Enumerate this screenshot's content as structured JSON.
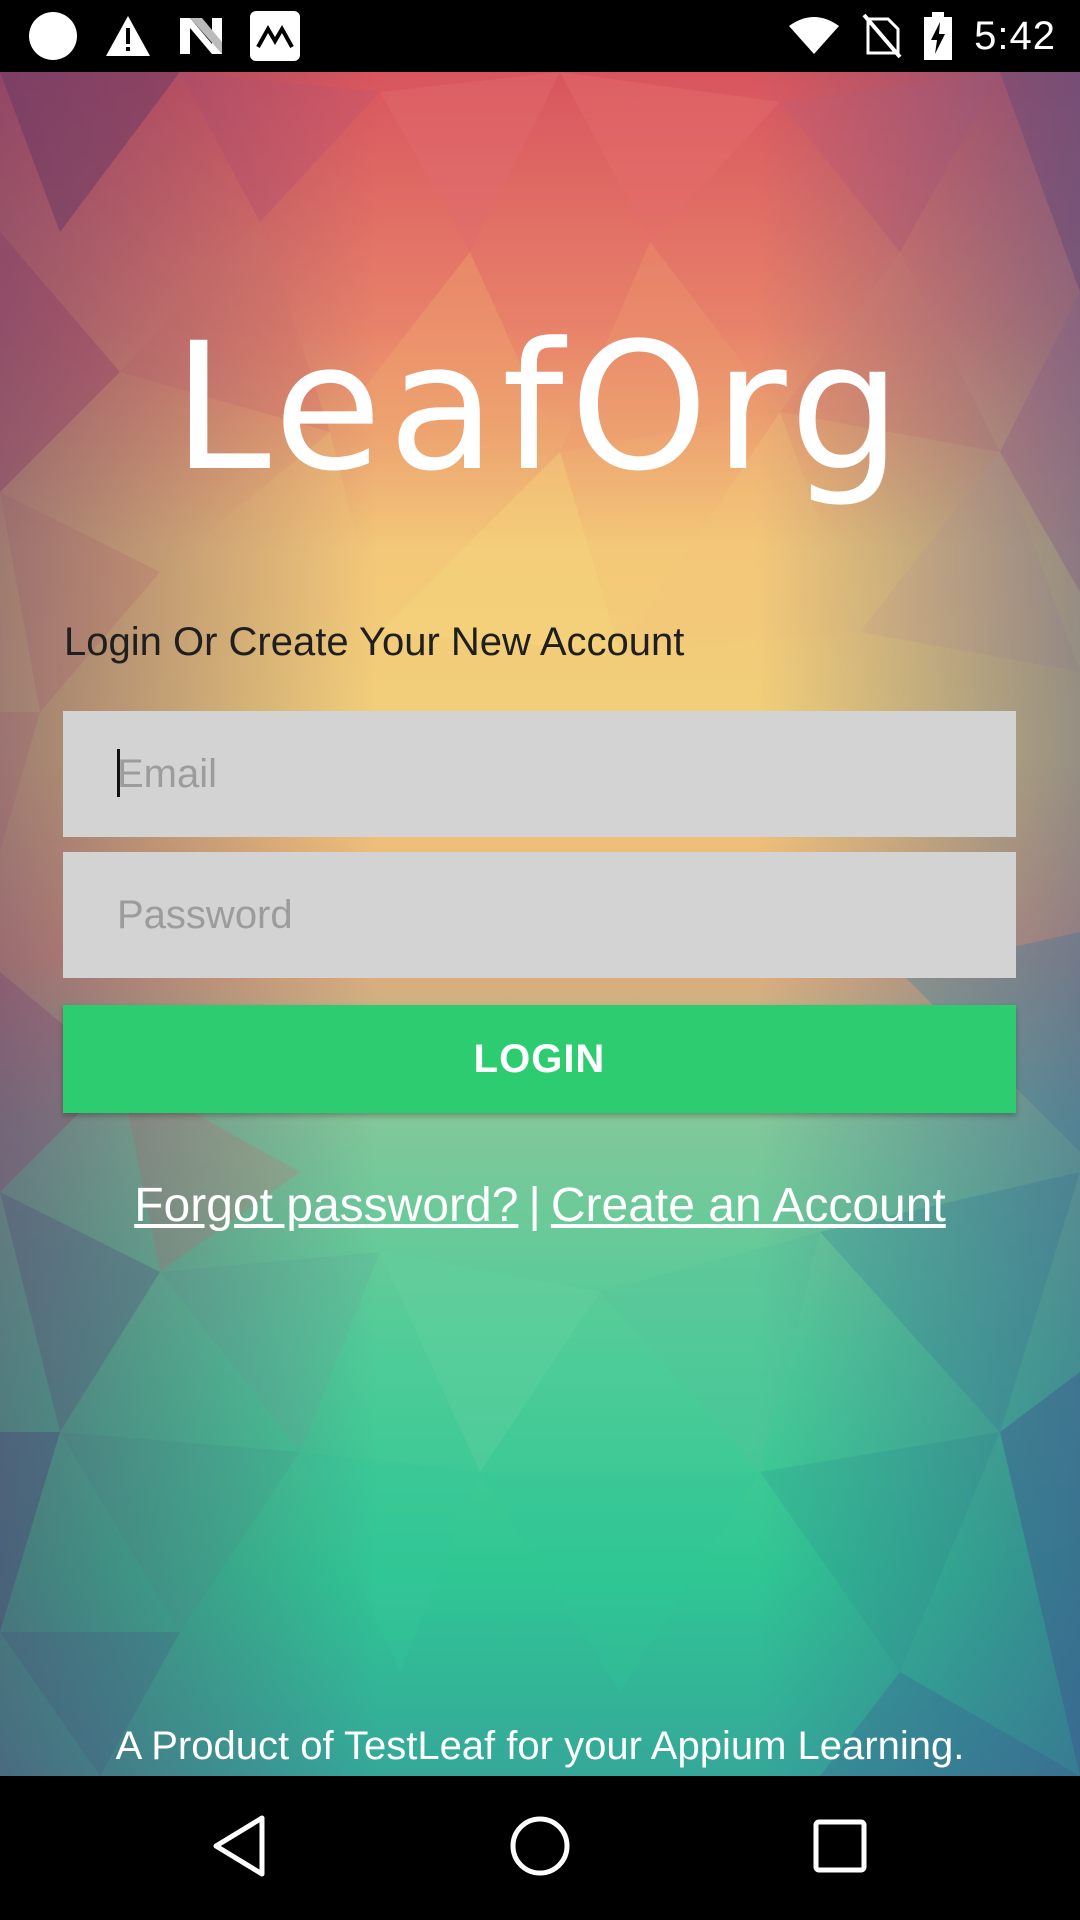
{
  "status_bar": {
    "time": "5:42",
    "icons_left": [
      "circle-icon",
      "warning-icon",
      "n-logo-icon",
      "app-icon"
    ],
    "icons_right": [
      "wifi-icon",
      "no-sim-icon",
      "battery-charging-icon"
    ]
  },
  "app": {
    "title": "LeafOrg",
    "subtitle": "Login Or Create Your New Account",
    "email_placeholder": "Email",
    "password_placeholder": "Password",
    "login_label": "LOGIN",
    "forgot_password": "Forgot password?",
    "separator": "|",
    "create_account": "Create an Account",
    "footer": "A Product of TestLeaf for your Appium Learning.",
    "colors": {
      "login_button": "#2ecc71",
      "input_background": "#d3d3d3"
    }
  },
  "nav_bar": {
    "back": "back-icon",
    "home": "home-icon",
    "recents": "recents-icon"
  }
}
